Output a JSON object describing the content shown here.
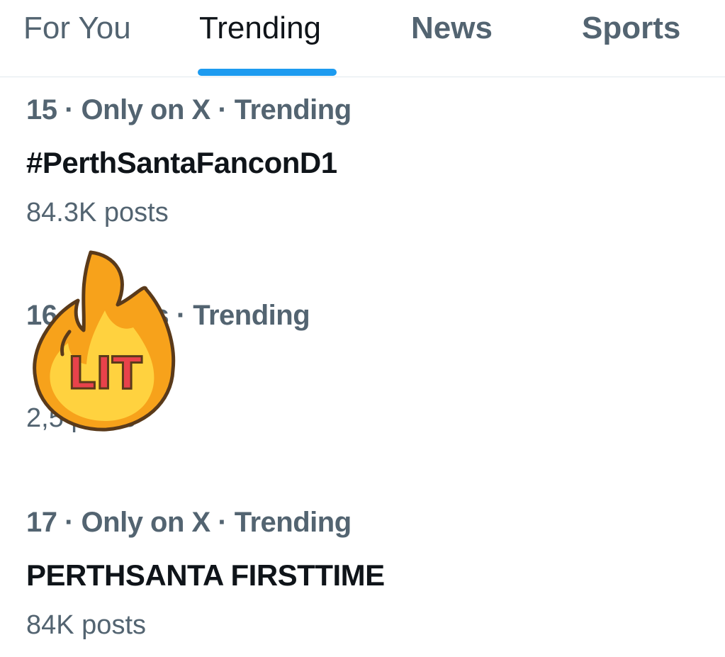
{
  "tabs": [
    {
      "label": "For You",
      "active": false
    },
    {
      "label": "Trending",
      "active": true
    },
    {
      "label": "News",
      "active": false
    },
    {
      "label": "Sports",
      "active": false
    }
  ],
  "colors": {
    "accent": "#1d9bf0",
    "text_primary": "#0f1419",
    "text_secondary": "#536471",
    "divider": "#e1e8ed",
    "flame_outer": "#f7a21b",
    "flame_inner": "#ffd23f",
    "sticker_text": "#e8424b"
  },
  "trends": [
    {
      "meta": "15 · Only on X · Trending",
      "name": "#PerthSantaFanconD1",
      "count": "84.3K posts"
    },
    {
      "meta": "16 · Sports · Trending",
      "name": "",
      "count": "2,5 posts"
    },
    {
      "meta": "17 · Only on X · Trending",
      "name": "PERTHSANTA FIRSTTIME",
      "count": "84K posts"
    }
  ],
  "sticker": {
    "text": "LIT",
    "icon": "fire-icon"
  }
}
